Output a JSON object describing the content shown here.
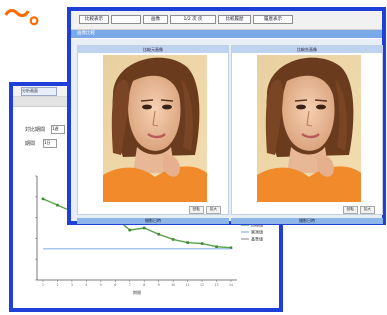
{
  "decoration": {
    "tilde": "～。",
    "color": "#ff6a00"
  },
  "back_window": {
    "tab_label": "分析画面",
    "toolbar_buttons": [
      "",
      "",
      ""
    ],
    "row1_label": "対比期間",
    "row1_value": "1週",
    "row2_label": "期間",
    "row2_value": "1日",
    "chart_data": {
      "type": "line",
      "title": "",
      "xlabel": "期間",
      "ylabel": "",
      "x": [
        1,
        2,
        3,
        4,
        5,
        6,
        7,
        8,
        9,
        10,
        11,
        12,
        13,
        14
      ],
      "series": [
        {
          "name": "",
          "values": [
            4.8,
            4.2,
            3.6,
            3.4,
            3.2,
            3.0,
            1.8,
            2.0,
            1.4,
            0.9,
            0.6,
            0.5,
            0.2,
            0.1
          ],
          "color": "#5aa348"
        },
        {
          "name": "",
          "values": [
            0,
            0,
            0,
            0,
            0,
            0,
            0,
            0,
            0,
            0,
            0,
            0,
            0,
            0
          ],
          "color": "#8bb3e8"
        }
      ],
      "legend": [
        "目標値",
        "実測値",
        "基準値"
      ],
      "legend_position": "right",
      "ylim": [
        -3,
        7
      ],
      "grid": false
    }
  },
  "front_window": {
    "tabs": [
      {
        "label": "比較表示",
        "active": true
      },
      {
        "label": "",
        "active": false
      },
      {
        "label": "画像",
        "active": true
      },
      {
        "label": "1/2 次 戻",
        "active": false
      },
      {
        "label": "比較履歴",
        "active": true
      },
      {
        "label": "履歴表示",
        "active": false
      }
    ],
    "section_label": "画像比較",
    "panels": [
      {
        "header": "比較元画像",
        "buttons": [
          "回転",
          "拡大"
        ],
        "footer": "撮影日時"
      },
      {
        "header": "比較先画像",
        "buttons": [
          "回転",
          "拡大"
        ],
        "footer": "撮影日時"
      }
    ]
  }
}
